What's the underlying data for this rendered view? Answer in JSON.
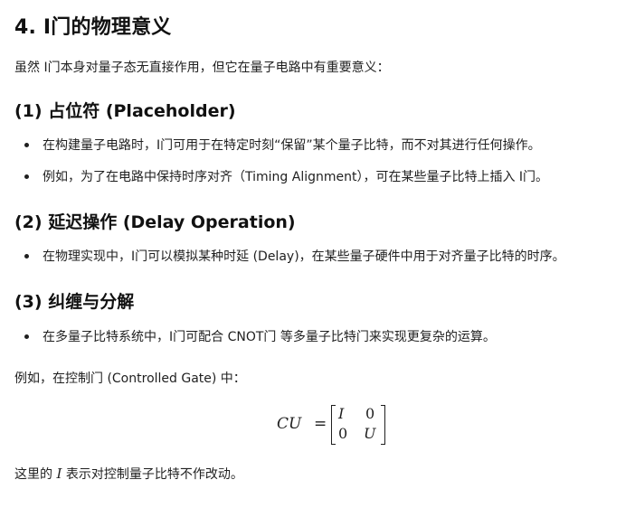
{
  "title": "4. I门的物理意义",
  "intro": "虽然 I门本身对量子态无直接作用，但它在量子电路中有重要意义：",
  "sections": [
    {
      "heading": "(1) 占位符 (Placeholder)",
      "bullets": [
        "在构建量子电路时，I门可用于在特定时刻“保留”某个量子比特，而不对其进行任何操作。",
        "例如，为了在电路中保持时序对齐（Timing Alignment），可在某些量子比特上插入 I门。"
      ]
    },
    {
      "heading": "(2) 延迟操作 (Delay Operation)",
      "bullets": [
        "在物理实现中，I门可以模拟某种时延 (Delay)，在某些量子硬件中用于对齐量子比特的时序。"
      ]
    },
    {
      "heading": "(3) 纠缠与分解",
      "bullets": [
        "在多量子比特系统中，I门可配合 CNOT门 等多量子比特门来实现更复杂的运算。"
      ]
    }
  ],
  "example_text": "例如，在控制门 (Controlled Gate) 中：",
  "equation": {
    "lhs": "CU",
    "equals": "=",
    "matrix": [
      [
        "I",
        "0"
      ],
      [
        "0",
        "U"
      ]
    ]
  },
  "closing": {
    "prefix": "这里的 ",
    "symbol": "I",
    "suffix": " 表示对控制量子比特不作改动。"
  }
}
